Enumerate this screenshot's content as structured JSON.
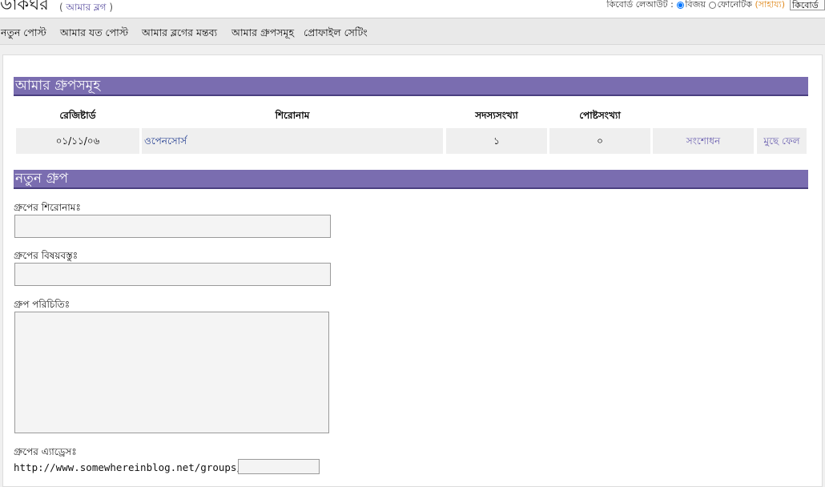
{
  "header": {
    "logo": "ডাকঘর",
    "blog_link_open": "( ",
    "blog_link": "আমার ব্লগ",
    "blog_link_close": " )",
    "keyboard_layout_label": "কিবোর্ড লেআউট :",
    "option_bijoy": "বিজয়",
    "option_phonetic": "ফোনেটিক",
    "help": "(সাহায্য)",
    "keyboard_button": "কিবোর্ড"
  },
  "nav": {
    "items": [
      "নতুন পোস্ট",
      "আমার যত পোস্ট",
      "আমার ব্লগের মন্তব্য",
      "আমার গ্রুপসমূহ",
      "প্রোফাইল সেটিং"
    ]
  },
  "groups": {
    "title": "আমার গ্রুপসমূহ",
    "columns": [
      "রেজিষ্টার্ড",
      "শিরোনাম",
      "সদস্যসংখ্যা",
      "পোষ্টসংখ্যা"
    ],
    "rows": [
      {
        "registered": "০১/১১/০৬",
        "title": "ওপেনসোর্স",
        "members": "১",
        "posts": "০",
        "edit": "সংশোধন",
        "delete": "মুছে ফেল"
      }
    ]
  },
  "new_group": {
    "title": "নতুন গ্রুপ",
    "title_label": "গ্রুপের শিরোনামঃ",
    "subject_label": "গ্রুপের বিষয়বস্তুঃ",
    "intro_label": "গ্রুপ পরিচিতিঃ",
    "address_label": "গ্রুপের এ্যাড্রেসঃ",
    "address_prefix": "http://www.somewhereinblog.net/groups/"
  }
}
